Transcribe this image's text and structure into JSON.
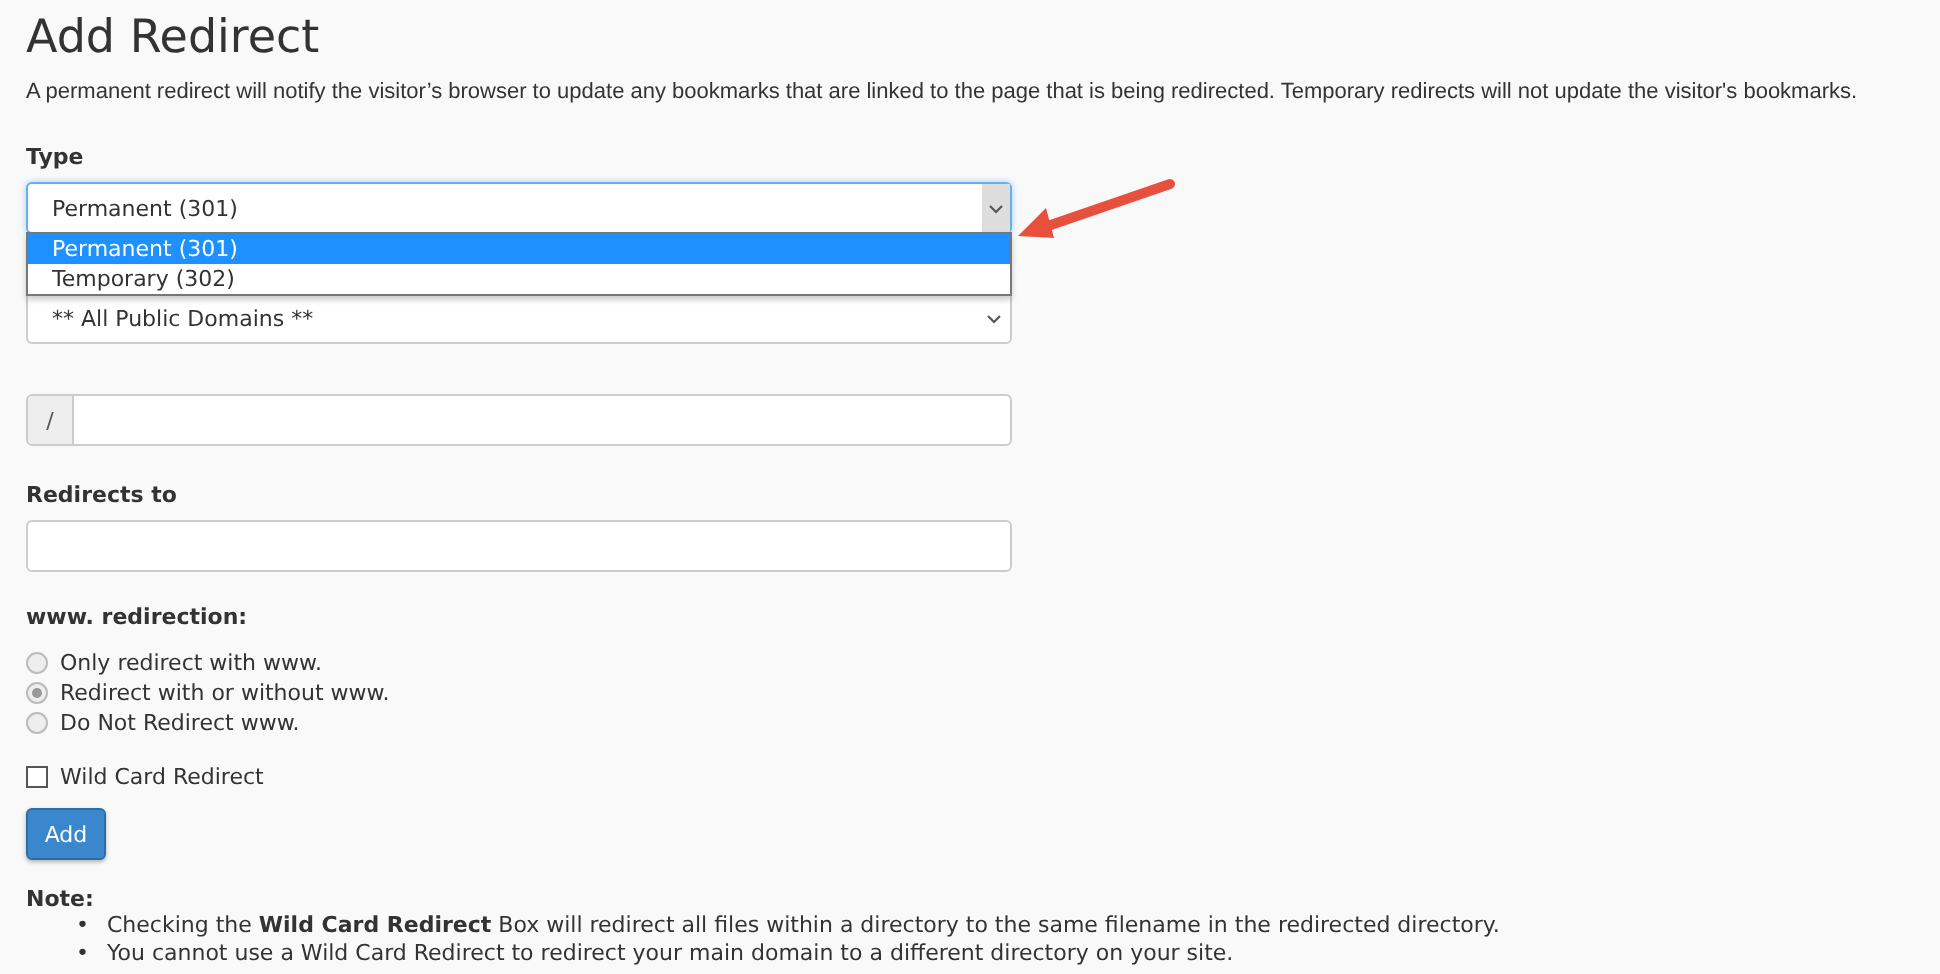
{
  "title": "Add Redirect",
  "description": "A permanent redirect will notify the visitor’s browser to update any bookmarks that are linked to the page that is being redirected. Temporary redirects will not update the visitor's bookmarks.",
  "type_select": {
    "label": "Type",
    "value": "Permanent (301)",
    "expanded": true,
    "options": [
      {
        "label": "Permanent (301)",
        "selected": true
      },
      {
        "label": "Temporary (302)",
        "selected": false
      }
    ]
  },
  "domain_select": {
    "value": "** All Public Domains **"
  },
  "path_field": {
    "prefix": "/"
  },
  "redirects_to": {
    "label": "Redirects to"
  },
  "www_redirection": {
    "label": "www. redirection:",
    "options": [
      {
        "label": "Only redirect with www.",
        "selected": false
      },
      {
        "label": "Redirect with or without www.",
        "selected": true
      },
      {
        "label": "Do Not Redirect www.",
        "selected": false
      }
    ]
  },
  "wildcard": {
    "label": "Wild Card Redirect",
    "checked": false
  },
  "add_button": "Add",
  "note": {
    "title": "Note:",
    "bullet": "•",
    "items": [
      "Checking the **Wild Card Redirect** Box will redirect all files within a directory to the same filename in the redirected directory.",
      "You cannot use a Wild Card Redirect to redirect your main domain to a different directory on your site."
    ]
  }
}
